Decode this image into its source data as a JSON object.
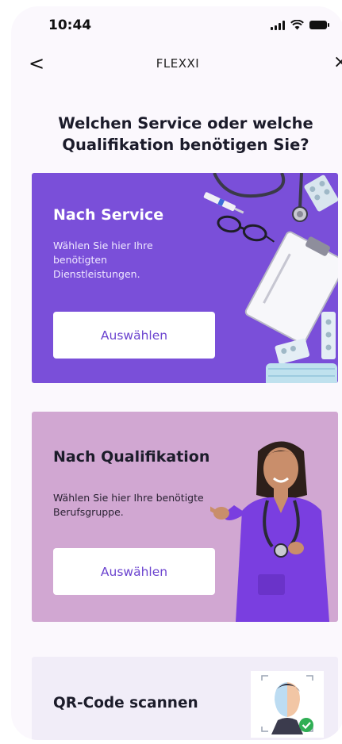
{
  "status_bar": {
    "time": "10:44"
  },
  "nav": {
    "back_glyph": "<",
    "title": "FLEXXI",
    "close_glyph": "×"
  },
  "heading": "Welchen Service oder welche Qualifikation benötigen Sie?",
  "cards": {
    "service": {
      "title": "Nach Service",
      "description": "Wählen Sie hier Ihre benötigten Dienstleistungen.",
      "button": "Auswählen"
    },
    "qualification": {
      "title": "Nach Qualifikation",
      "description": "Wählen Sie hier Ihre benötigte Berufsgruppe.",
      "button": "Auswählen"
    },
    "qr": {
      "title": "QR-Code scannen"
    }
  },
  "colors": {
    "service_card": "#7a4fd9",
    "qualification_card": "#d1a7d2",
    "qr_card": "#f1edf8",
    "button_text": "#6b43cf"
  }
}
